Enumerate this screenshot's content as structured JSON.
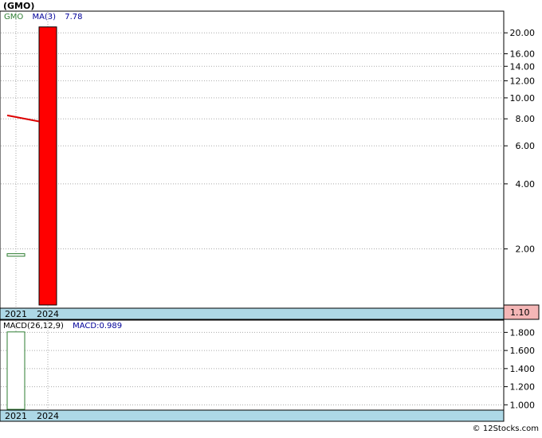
{
  "header": {
    "title": "(GMO)"
  },
  "footer": {
    "credit": "© 12Stocks.com"
  },
  "legend": {
    "symbol": "GMO",
    "ma_label": "MA(3)",
    "ma_value": "7.78",
    "macd_params": "MACD(26,12,9)",
    "macd_value": "MACD:0.989"
  },
  "colors": {
    "price_candle_fill": "#ffffff",
    "price_candle_stroke": "#2e7d32",
    "bar_fill": "#ff0000",
    "ma_line": "#dd0000",
    "axis_band": "#add8e6",
    "last_price_box": "#f4b6b6",
    "grid": "#aaaaaa",
    "frame": "#000000",
    "legend_symbol": "#2e7d32",
    "legend_ma": "#000099"
  },
  "chart_data": [
    {
      "type": "bar",
      "scale": "log",
      "categories": [
        "2021",
        "2024"
      ],
      "y_ticks": [
        "20.00",
        "16.00",
        "14.00",
        "12.00",
        "10.00",
        "8.00",
        "6.00",
        "4.00",
        "2.00"
      ],
      "last_price_label": "1.10",
      "ylim": [
        1.1,
        22
      ],
      "series": [
        {
          "name": "GMO",
          "kind": "candle",
          "points": [
            {
              "x": "2021",
              "low": 1.85,
              "high": 1.9
            }
          ]
        },
        {
          "kind": "bar",
          "points": [
            {
              "x": "2024",
              "low": 1.1,
              "high": 21.3
            }
          ]
        },
        {
          "name": "MA(3)",
          "kind": "line",
          "points": [
            {
              "x": "2021",
              "y": 8.3
            },
            {
              "x": "2024",
              "y": 7.78
            }
          ]
        }
      ]
    },
    {
      "type": "bar",
      "categories": [
        "2021",
        "2024"
      ],
      "y_ticks": [
        "1.800",
        "1.600",
        "1.400",
        "1.200",
        "1.000"
      ],
      "ylim": [
        0.95,
        1.9
      ],
      "series": [
        {
          "name": "MACD(26,12,9)",
          "kind": "bar",
          "points": [
            {
              "x": "2021",
              "y": 1.805
            }
          ]
        }
      ]
    }
  ]
}
